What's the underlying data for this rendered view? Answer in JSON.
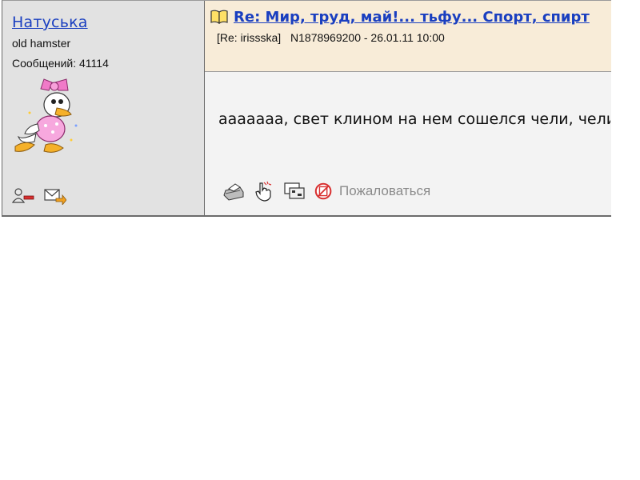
{
  "author": {
    "name": "Натуська",
    "rank": "old hamster",
    "posts_count": "Сообщений: 41114"
  },
  "post": {
    "title": "Re: Мир, труд, май!... тьфу... Спорт, спирт",
    "reply_to": "[Re: irissska]",
    "meta": "N1878969200 - 26.01.11 10:00",
    "message": "ааааааа, свет клином на нем сошелся чели, чели"
  },
  "actions": {
    "complain_label": "Пожаловаться"
  },
  "icons": {
    "title": "book-icon",
    "user": [
      "remove-user-icon",
      "send-message-icon"
    ],
    "post": [
      "print-icon",
      "pointer-hand-icon",
      "forward-icon",
      "complain-icon"
    ]
  },
  "colors": {
    "link": "#1a3fc0",
    "header_bg": "#f8ecd8",
    "author_bg": "#e2e2e2",
    "complain_icon": "#d83030"
  }
}
